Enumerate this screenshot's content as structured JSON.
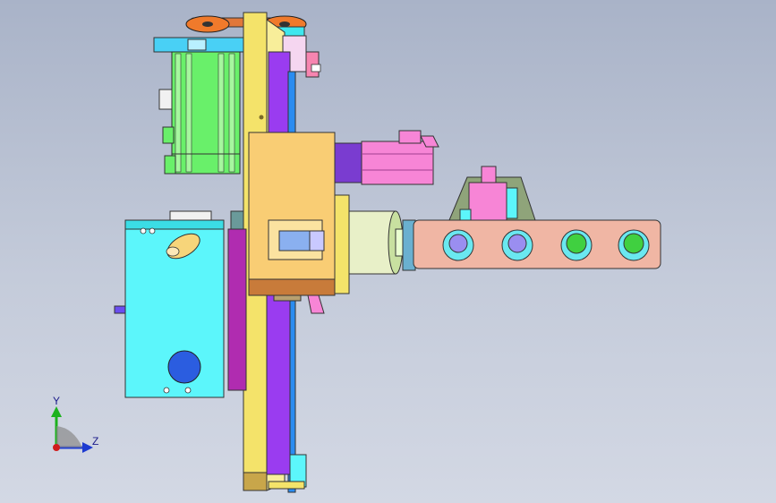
{
  "triad": {
    "y_label": "Y",
    "z_label": "Z"
  },
  "colors": {
    "background_top": "#a9b3c8",
    "background_bottom": "#d3d8e4",
    "frame_yellow": "#f4e36a",
    "housing_orange": "#f9cd74",
    "gearbox_cyan": "#5cf6fb",
    "motor_green": "#69f06a",
    "motor_pink": "#f785d6",
    "rail_purple": "#9a3cf0",
    "arm_salmon": "#f0b6a4",
    "pulley_orange": "#f07a2b",
    "plate_magenta": "#b02cb0"
  },
  "icons": [
    "axis-triad-icon"
  ]
}
